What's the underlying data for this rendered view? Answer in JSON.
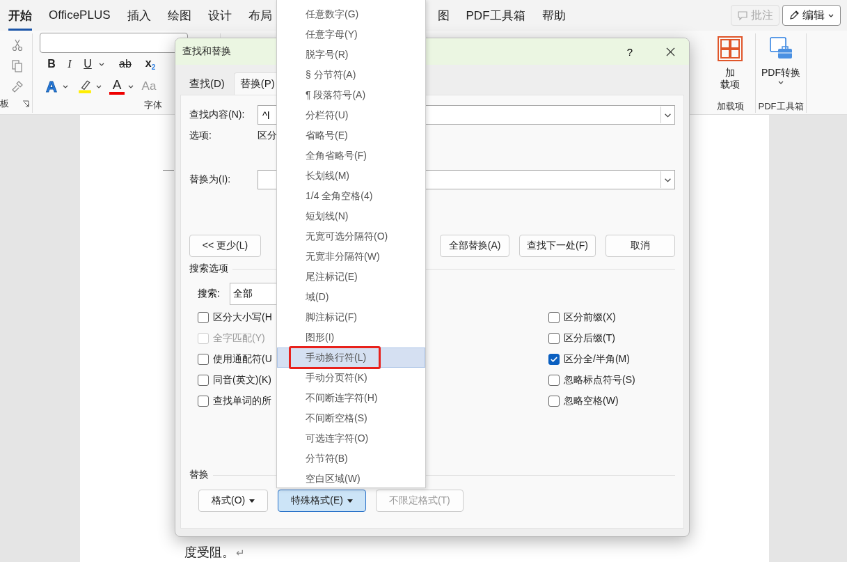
{
  "ribbon_tabs": [
    {
      "label": "开始",
      "selected": true
    },
    {
      "label": "OfficePLUS",
      "selected": false
    },
    {
      "label": "插入",
      "selected": false
    },
    {
      "label": "绘图",
      "selected": false
    },
    {
      "label": "设计",
      "selected": false
    },
    {
      "label": "布局",
      "selected": false
    },
    {
      "label": "图",
      "selected": false
    },
    {
      "label": "PDF工具箱",
      "selected": false
    },
    {
      "label": "帮助",
      "selected": false
    }
  ],
  "top_buttons": [
    {
      "label": "批注",
      "kind": "comments",
      "disabled": true
    },
    {
      "label": "编辑",
      "kind": "editing",
      "disabled": false
    }
  ],
  "ribbon": {
    "clipboard_group": "板",
    "font_group": "字体",
    "format_row_1": [
      {
        "kind": "bold",
        "label": "B",
        "dropdown": false
      },
      {
        "kind": "italic",
        "label": "I",
        "dropdown": false
      },
      {
        "kind": "underline",
        "label": "U",
        "dropdown": true
      },
      {
        "kind": "strike",
        "label": "ab",
        "dropdown": false
      },
      {
        "kind": "subscript",
        "label": "x$_{2}$",
        "dropdown": false
      }
    ],
    "format_row_2": [
      {
        "kind": "effects",
        "label": "A",
        "dropdown": true
      },
      {
        "kind": "highlight",
        "dropdown": true
      },
      {
        "kind": "color",
        "label": "A",
        "dropdown": true
      },
      {
        "kind": "case",
        "label": "Aa",
        "dropdown": false
      }
    ],
    "addins": {
      "button_lines": [
        "加",
        "载项"
      ],
      "group": "加载项"
    },
    "pdf": {
      "button": "PDF转换",
      "group": "PDF工具箱"
    }
  },
  "dialog": {
    "title": "查找和替换",
    "help": "?",
    "tabs": [
      {
        "label": "查找(D)",
        "selected": false
      },
      {
        "label": "替换(P)",
        "selected": true
      }
    ],
    "find": {
      "label": "查找内容(N):",
      "value": "^l"
    },
    "options": {
      "label": "选项:",
      "value": "区分"
    },
    "replace": {
      "label": "替换为(I):"
    },
    "buttons": [
      {
        "label": "<< 更少(L)"
      },
      {
        "label": "全部替换(A)"
      },
      {
        "label": "查找下一处(F)"
      },
      {
        "label": "取消"
      }
    ],
    "search_options": {
      "title": "搜索选项",
      "search_label": "搜索:",
      "search_value": "全部"
    },
    "checkboxes_left": [
      {
        "label": "区分大小写(H",
        "checked": false,
        "disabled": false
      },
      {
        "label": "全字匹配(Y)",
        "checked": false,
        "disabled": true
      },
      {
        "label": "使用通配符(U",
        "checked": false,
        "disabled": false
      },
      {
        "label": "同音(英文)(K)",
        "checked": false,
        "disabled": false
      },
      {
        "label": "查找单词的所",
        "checked": false,
        "disabled": false
      }
    ],
    "checkboxes_right": [
      {
        "label": "区分前缀(X)",
        "checked": false,
        "disabled": false
      },
      {
        "label": "区分后缀(T)",
        "checked": false,
        "disabled": false
      },
      {
        "label": "区分全/半角(M)",
        "checked": true,
        "disabled": false
      },
      {
        "label": "忽略标点符号(S)",
        "checked": false,
        "disabled": false
      },
      {
        "label": "忽略空格(W)",
        "checked": false,
        "disabled": false
      }
    ],
    "replace_section": {
      "title": "替换",
      "buttons": [
        {
          "label": "格式(O)",
          "dropdown": true,
          "active": false,
          "disabled": false
        },
        {
          "label": "特殊格式(E)",
          "dropdown": true,
          "active": true,
          "disabled": false
        },
        {
          "label": "不限定格式(T)",
          "dropdown": false,
          "active": false,
          "disabled": true
        }
      ]
    }
  },
  "special_menu": [
    {
      "label": "任意数字(G)",
      "selected": false,
      "annotated": false
    },
    {
      "label": "任意字母(Y)",
      "selected": false,
      "annotated": false
    },
    {
      "label": "脱字号(R)",
      "selected": false,
      "annotated": false
    },
    {
      "label": "§ 分节符(A)",
      "selected": false,
      "annotated": false
    },
    {
      "label": "¶ 段落符号(A)",
      "selected": false,
      "annotated": false
    },
    {
      "label": "分栏符(U)",
      "selected": false,
      "annotated": false
    },
    {
      "label": "省略号(E)",
      "selected": false,
      "annotated": false
    },
    {
      "label": "全角省略号(F)",
      "selected": false,
      "annotated": false
    },
    {
      "label": "长划线(M)",
      "selected": false,
      "annotated": false
    },
    {
      "label": "1/4 全角空格(4)",
      "selected": false,
      "annotated": false
    },
    {
      "label": "短划线(N)",
      "selected": false,
      "annotated": false
    },
    {
      "label": "无宽可选分隔符(O)",
      "selected": false,
      "annotated": false
    },
    {
      "label": "无宽非分隔符(W)",
      "selected": false,
      "annotated": false
    },
    {
      "label": "尾注标记(E)",
      "selected": false,
      "annotated": false
    },
    {
      "label": "域(D)",
      "selected": false,
      "annotated": false
    },
    {
      "label": "脚注标记(F)",
      "selected": false,
      "annotated": false
    },
    {
      "label": "图形(I)",
      "selected": false,
      "annotated": false
    },
    {
      "label": "手动换行符(L)",
      "selected": true,
      "annotated": true
    },
    {
      "label": "手动分页符(K)",
      "selected": false,
      "annotated": false
    },
    {
      "label": "不间断连字符(H)",
      "selected": false,
      "annotated": false
    },
    {
      "label": "不间断空格(S)",
      "selected": false,
      "annotated": false
    },
    {
      "label": "可选连字符(O)",
      "selected": false,
      "annotated": false
    },
    {
      "label": "分节符(B)",
      "selected": false,
      "annotated": false
    },
    {
      "label": "空白区域(W)",
      "selected": false,
      "annotated": false
    }
  ],
  "document": {
    "text": "度受阻。",
    "mark": "↵"
  }
}
